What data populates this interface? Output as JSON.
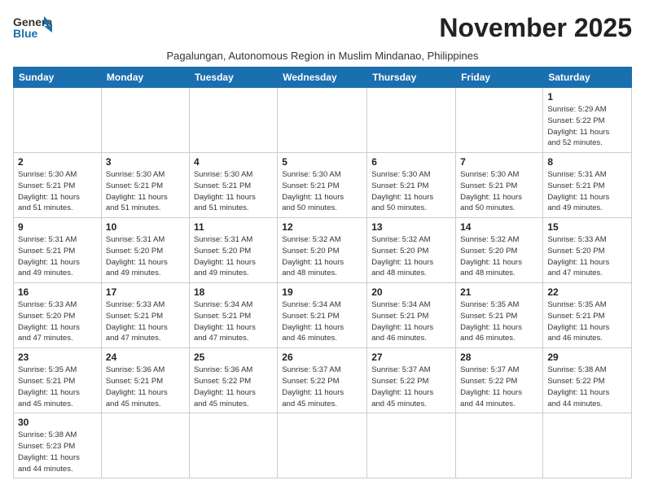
{
  "header": {
    "logo_general": "General",
    "logo_blue": "Blue",
    "month_title": "November 2025",
    "subtitle": "Pagalungan, Autonomous Region in Muslim Mindanao, Philippines"
  },
  "days_of_week": [
    "Sunday",
    "Monday",
    "Tuesday",
    "Wednesday",
    "Thursday",
    "Friday",
    "Saturday"
  ],
  "weeks": [
    [
      {
        "day": "",
        "info": ""
      },
      {
        "day": "",
        "info": ""
      },
      {
        "day": "",
        "info": ""
      },
      {
        "day": "",
        "info": ""
      },
      {
        "day": "",
        "info": ""
      },
      {
        "day": "",
        "info": ""
      },
      {
        "day": "1",
        "info": "Sunrise: 5:29 AM\nSunset: 5:22 PM\nDaylight: 11 hours\nand 52 minutes."
      }
    ],
    [
      {
        "day": "2",
        "info": "Sunrise: 5:30 AM\nSunset: 5:21 PM\nDaylight: 11 hours\nand 51 minutes."
      },
      {
        "day": "3",
        "info": "Sunrise: 5:30 AM\nSunset: 5:21 PM\nDaylight: 11 hours\nand 51 minutes."
      },
      {
        "day": "4",
        "info": "Sunrise: 5:30 AM\nSunset: 5:21 PM\nDaylight: 11 hours\nand 51 minutes."
      },
      {
        "day": "5",
        "info": "Sunrise: 5:30 AM\nSunset: 5:21 PM\nDaylight: 11 hours\nand 50 minutes."
      },
      {
        "day": "6",
        "info": "Sunrise: 5:30 AM\nSunset: 5:21 PM\nDaylight: 11 hours\nand 50 minutes."
      },
      {
        "day": "7",
        "info": "Sunrise: 5:30 AM\nSunset: 5:21 PM\nDaylight: 11 hours\nand 50 minutes."
      },
      {
        "day": "8",
        "info": "Sunrise: 5:31 AM\nSunset: 5:21 PM\nDaylight: 11 hours\nand 49 minutes."
      }
    ],
    [
      {
        "day": "9",
        "info": "Sunrise: 5:31 AM\nSunset: 5:21 PM\nDaylight: 11 hours\nand 49 minutes."
      },
      {
        "day": "10",
        "info": "Sunrise: 5:31 AM\nSunset: 5:20 PM\nDaylight: 11 hours\nand 49 minutes."
      },
      {
        "day": "11",
        "info": "Sunrise: 5:31 AM\nSunset: 5:20 PM\nDaylight: 11 hours\nand 49 minutes."
      },
      {
        "day": "12",
        "info": "Sunrise: 5:32 AM\nSunset: 5:20 PM\nDaylight: 11 hours\nand 48 minutes."
      },
      {
        "day": "13",
        "info": "Sunrise: 5:32 AM\nSunset: 5:20 PM\nDaylight: 11 hours\nand 48 minutes."
      },
      {
        "day": "14",
        "info": "Sunrise: 5:32 AM\nSunset: 5:20 PM\nDaylight: 11 hours\nand 48 minutes."
      },
      {
        "day": "15",
        "info": "Sunrise: 5:33 AM\nSunset: 5:20 PM\nDaylight: 11 hours\nand 47 minutes."
      }
    ],
    [
      {
        "day": "16",
        "info": "Sunrise: 5:33 AM\nSunset: 5:20 PM\nDaylight: 11 hours\nand 47 minutes."
      },
      {
        "day": "17",
        "info": "Sunrise: 5:33 AM\nSunset: 5:21 PM\nDaylight: 11 hours\nand 47 minutes."
      },
      {
        "day": "18",
        "info": "Sunrise: 5:34 AM\nSunset: 5:21 PM\nDaylight: 11 hours\nand 47 minutes."
      },
      {
        "day": "19",
        "info": "Sunrise: 5:34 AM\nSunset: 5:21 PM\nDaylight: 11 hours\nand 46 minutes."
      },
      {
        "day": "20",
        "info": "Sunrise: 5:34 AM\nSunset: 5:21 PM\nDaylight: 11 hours\nand 46 minutes."
      },
      {
        "day": "21",
        "info": "Sunrise: 5:35 AM\nSunset: 5:21 PM\nDaylight: 11 hours\nand 46 minutes."
      },
      {
        "day": "22",
        "info": "Sunrise: 5:35 AM\nSunset: 5:21 PM\nDaylight: 11 hours\nand 46 minutes."
      }
    ],
    [
      {
        "day": "23",
        "info": "Sunrise: 5:35 AM\nSunset: 5:21 PM\nDaylight: 11 hours\nand 45 minutes."
      },
      {
        "day": "24",
        "info": "Sunrise: 5:36 AM\nSunset: 5:21 PM\nDaylight: 11 hours\nand 45 minutes."
      },
      {
        "day": "25",
        "info": "Sunrise: 5:36 AM\nSunset: 5:22 PM\nDaylight: 11 hours\nand 45 minutes."
      },
      {
        "day": "26",
        "info": "Sunrise: 5:37 AM\nSunset: 5:22 PM\nDaylight: 11 hours\nand 45 minutes."
      },
      {
        "day": "27",
        "info": "Sunrise: 5:37 AM\nSunset: 5:22 PM\nDaylight: 11 hours\nand 45 minutes."
      },
      {
        "day": "28",
        "info": "Sunrise: 5:37 AM\nSunset: 5:22 PM\nDaylight: 11 hours\nand 44 minutes."
      },
      {
        "day": "29",
        "info": "Sunrise: 5:38 AM\nSunset: 5:22 PM\nDaylight: 11 hours\nand 44 minutes."
      }
    ],
    [
      {
        "day": "30",
        "info": "Sunrise: 5:38 AM\nSunset: 5:23 PM\nDaylight: 11 hours\nand 44 minutes."
      },
      {
        "day": "",
        "info": ""
      },
      {
        "day": "",
        "info": ""
      },
      {
        "day": "",
        "info": ""
      },
      {
        "day": "",
        "info": ""
      },
      {
        "day": "",
        "info": ""
      },
      {
        "day": "",
        "info": ""
      }
    ]
  ]
}
